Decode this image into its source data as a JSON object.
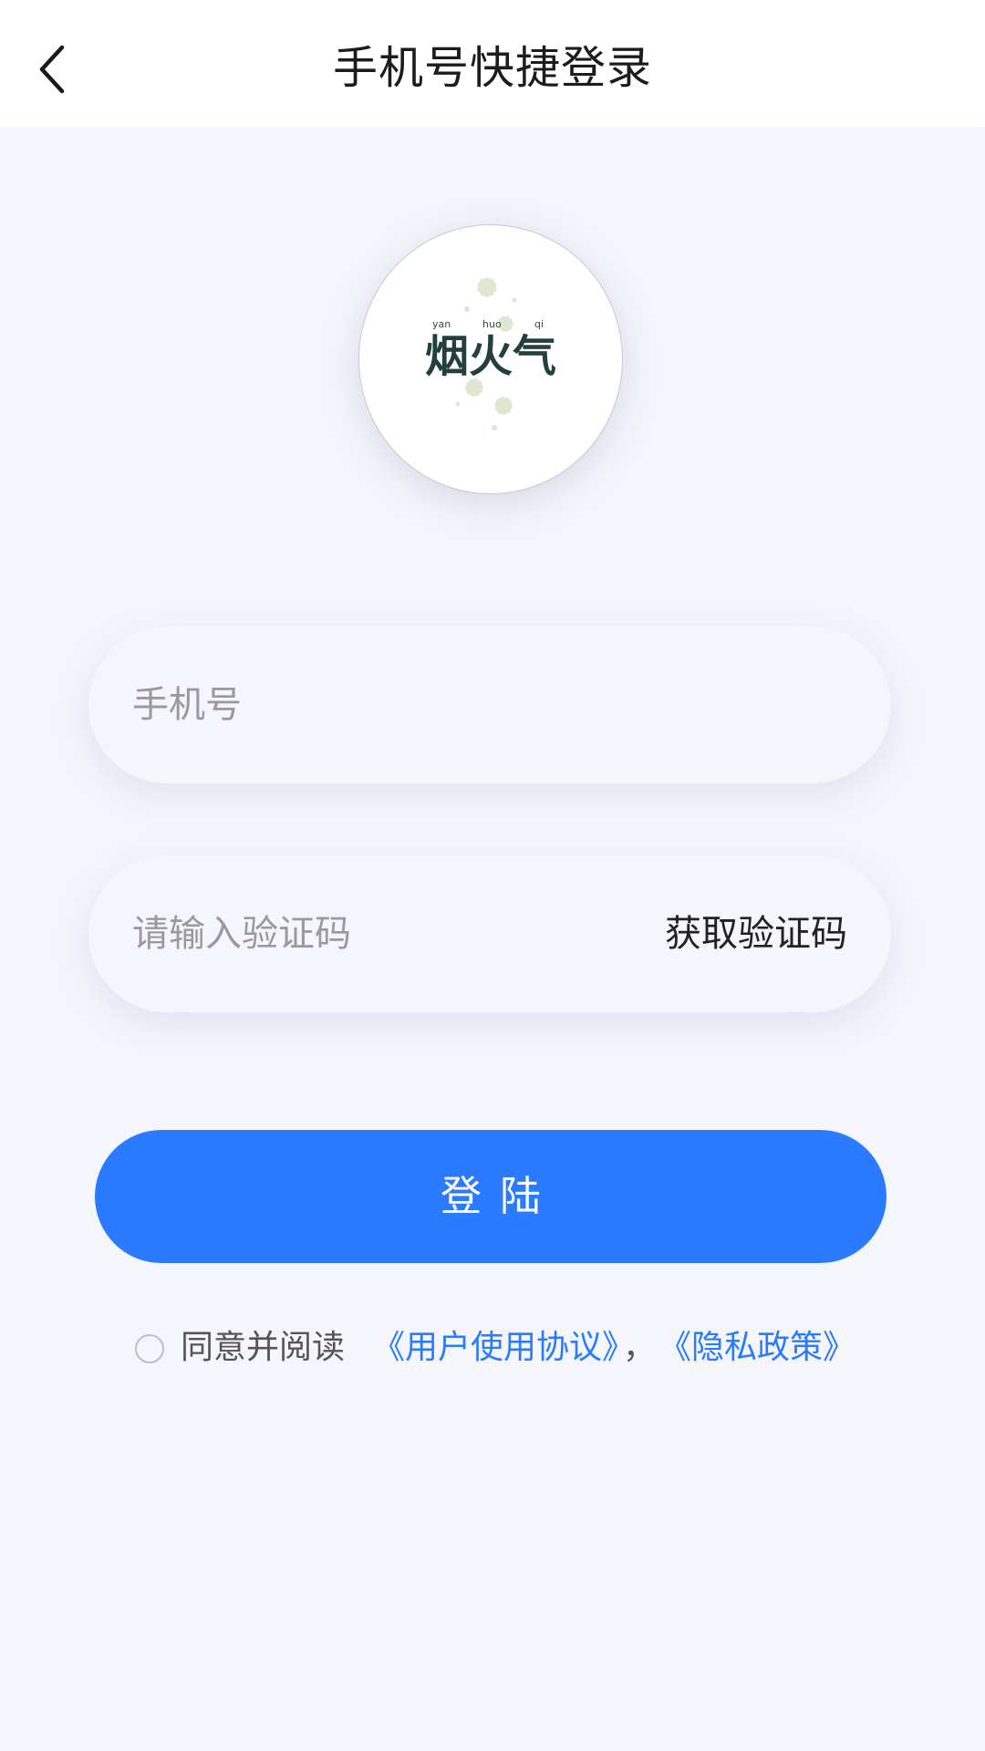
{
  "header": {
    "title": "手机号快捷登录"
  },
  "logo": {
    "text": "烟火气",
    "pinyin": [
      "yan",
      "huo",
      "qi"
    ]
  },
  "form": {
    "phone_placeholder": "手机号",
    "code_placeholder": "请输入验证码",
    "get_code_label": "获取验证码",
    "phone_value": "",
    "code_value": ""
  },
  "login_button": {
    "label": "登陆"
  },
  "agreement": {
    "text": "同意并阅读",
    "user_agreement": "《用户使用协议》",
    "separator": "，",
    "privacy_policy": "《隐私政策》",
    "checked": false
  },
  "colors": {
    "accent": "#2a7bff",
    "background": "#f5f6fc"
  },
  "icons": {
    "back": "chevron-left-icon"
  }
}
